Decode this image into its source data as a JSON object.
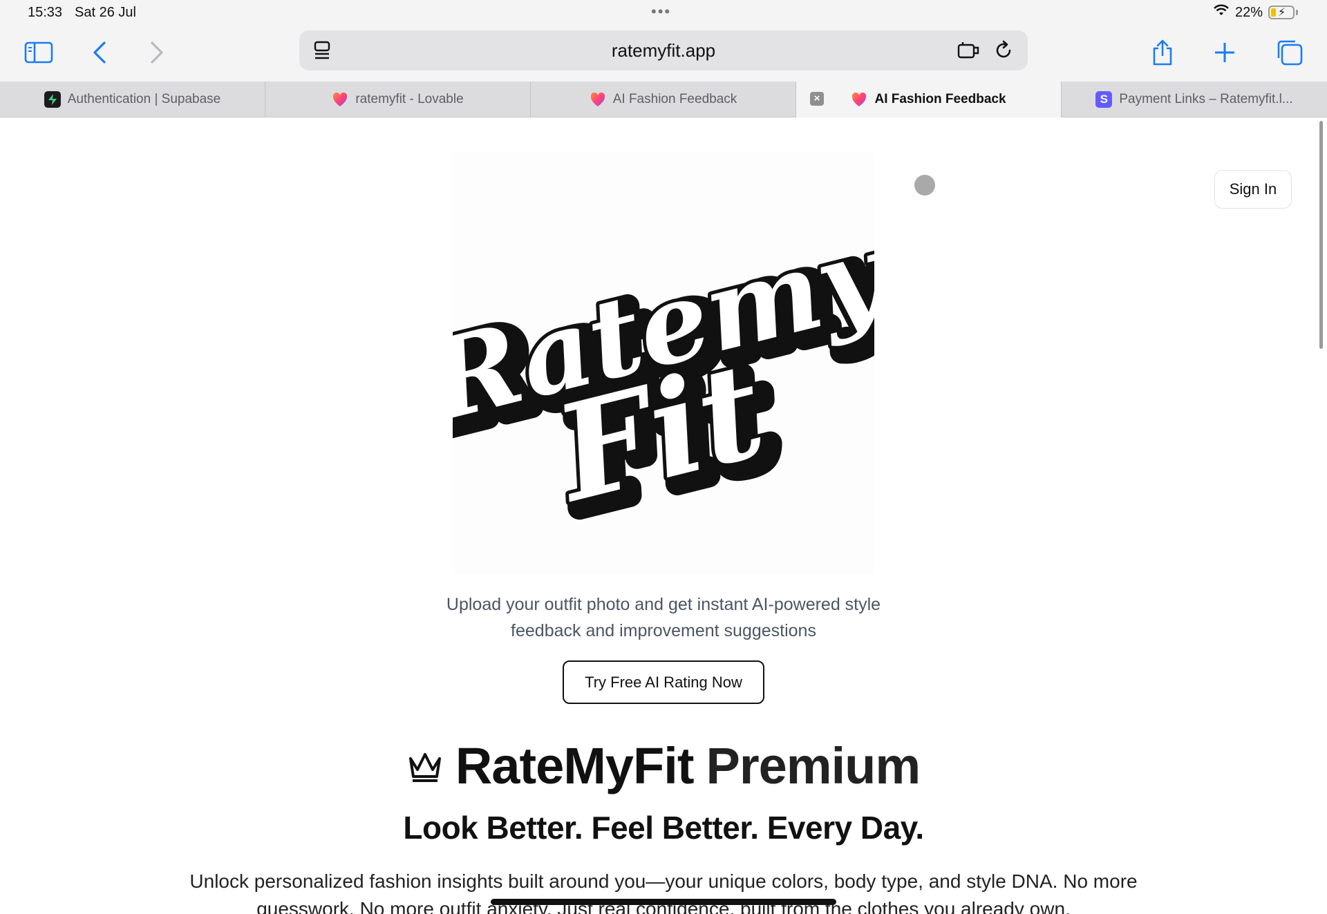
{
  "status_bar": {
    "time": "15:33",
    "date": "Sat 26 Jul",
    "battery": "22%",
    "battery_level": 0.22
  },
  "toolbar": {
    "url": "ratemyfit.app",
    "icons": [
      "sidebar-icon",
      "back-icon",
      "forward-icon",
      "page-menu-icon",
      "extensions-icon",
      "reload-icon",
      "share-icon",
      "new-tab-icon",
      "tabs-overview-icon"
    ]
  },
  "tabs": [
    {
      "title": "Authentication | Supabase",
      "favicon_color": "#1c1c1c",
      "active": false
    },
    {
      "title": "ratemyfit - Lovable",
      "favicon_color": "#ff4f6d",
      "active": false
    },
    {
      "title": "AI Fashion Feedback",
      "favicon_color": "#ff4f6d",
      "active": false
    },
    {
      "title": "AI Fashion Feedback",
      "favicon_color": "#ff4f6d",
      "active": true
    },
    {
      "title": "Payment Links – Ratemyfit.l...",
      "favicon_color": "#635bff",
      "active": false
    }
  ],
  "page": {
    "sign_in": "Sign In",
    "logo_text_line1": "Ratemy",
    "logo_text_line2": "Fit",
    "tagline_line1": "Upload your outfit photo and get instant AI-powered style",
    "tagline_line2": "feedback and improvement suggestions",
    "cta": "Try Free AI Rating Now",
    "premium_title_part1": "RateMyFit",
    "premium_title_part2": "Premium",
    "premium_subtitle": "Look Better. Feel Better. Every Day.",
    "body_line1": "Unlock personalized fashion insights built around you—your unique colors, body type, and style DNA. No more",
    "body_line2": "guesswork. No more outfit anxiety. Just real confidence, built from the clothes you already own."
  }
}
